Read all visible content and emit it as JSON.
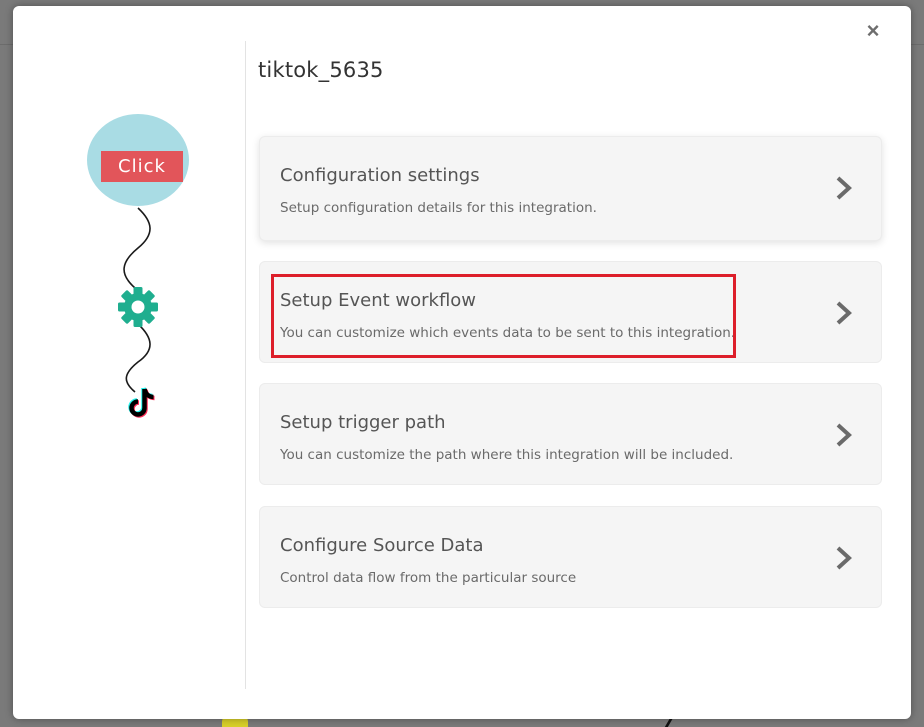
{
  "modal": {
    "close_label": "×",
    "title": "tiktok_5635"
  },
  "flow": {
    "trigger_label": "Click",
    "nodes": [
      "click-node",
      "gear-icon",
      "tiktok-icon"
    ],
    "colors": {
      "circle": "#a9dce4",
      "click_badge": "#e2555a",
      "gear": "#1fae8f",
      "connector": "#1a1a1a"
    }
  },
  "cards": [
    {
      "title": "Configuration settings",
      "description": "Setup configuration details for this integration."
    },
    {
      "title": "Setup Event workflow",
      "description": "You can customize which events data to be sent to this integration.",
      "highlighted": true
    },
    {
      "title": "Setup trigger path",
      "description": "You can customize the path where this integration will be included."
    },
    {
      "title": "Configure Source Data",
      "description": "Control data flow from the particular source"
    }
  ],
  "colors": {
    "highlight_border": "#dd1f2a",
    "card_bg": "#f5f5f5",
    "chevron": "#6a6a6a"
  }
}
